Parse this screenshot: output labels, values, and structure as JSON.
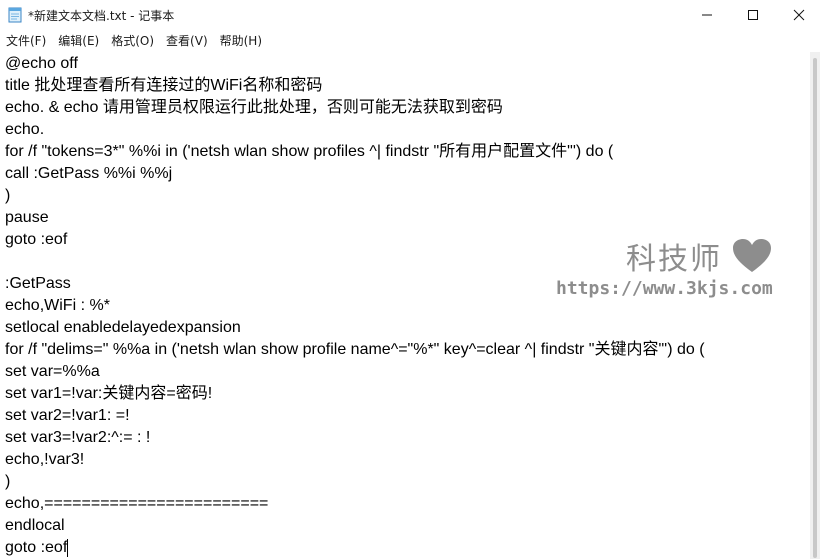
{
  "window": {
    "title": "*新建文本文档.txt - 记事本",
    "icons": {
      "app": "notepad-icon",
      "minimize": "minimize-icon",
      "maximize": "maximize-icon",
      "close": "close-icon"
    }
  },
  "menu": {
    "items": [
      "文件(F)",
      "编辑(E)",
      "格式(O)",
      "查看(V)",
      "帮助(H)"
    ]
  },
  "editor": {
    "lines": [
      "@echo off",
      "title 批处理查看所有连接过的WiFi名称和密码",
      "echo. & echo 请用管理员权限运行此批处理，否则可能无法获取到密码",
      "echo.",
      "for /f \"tokens=3*\" %%i in ('netsh wlan show profiles ^| findstr \"所有用户配置文件\"') do (",
      "call :GetPass %%i %%j",
      ")",
      "pause",
      "goto :eof",
      "",
      ":GetPass",
      "echo,WiFi : %*",
      "setlocal enabledelayedexpansion",
      "for /f \"delims=\" %%a in ('netsh wlan show profile name^=\"%*\" key^=clear ^| findstr \"关键内容\"') do (",
      "set var=%%a",
      "set var1=!var:关键内容=密码!",
      "set var2=!var1: =!",
      "set var3=!var2:^:= : !",
      "echo,!var3!",
      ")",
      "echo,========================",
      "endlocal",
      "goto :eof"
    ]
  },
  "watermark": {
    "brand": "科技师",
    "url": "https://www.3kjs.com",
    "icon": "heart-icon"
  }
}
